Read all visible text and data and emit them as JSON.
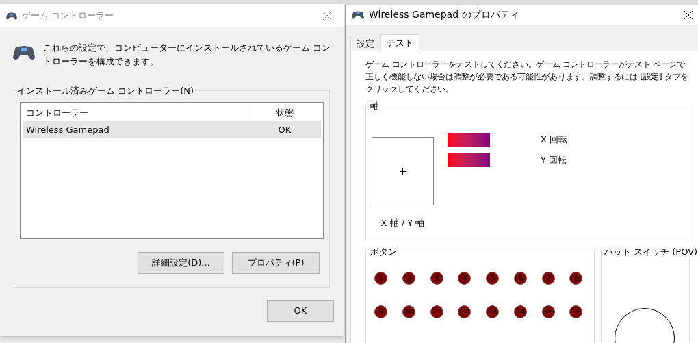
{
  "left_window": {
    "title": "ゲーム コントローラー",
    "description": "これらの設定で、コンピューターにインストールされているゲーム コントローラーを構成できます。",
    "group_label": "インストール済みゲーム コントローラー(N)",
    "columns": [
      "コントローラー",
      "状態"
    ],
    "rows": [
      {
        "name": "Wireless Gamepad",
        "status": "OK",
        "selected": true
      }
    ],
    "buttons": [
      "詳細設定(D)...",
      "プロパティ(P)"
    ],
    "ok_button": "OK"
  },
  "right_window": {
    "title": "Wireless Gamepad のプロパティ",
    "tabs": [
      {
        "label": "設定",
        "selected": false
      },
      {
        "label": "テスト",
        "selected": true
      }
    ],
    "description": "ゲーム コントローラーをテストしてください。ゲーム コントローラーがテスト ページで正しく機能しない場合は調整が必要である可能性があります。調整するには [設定] タブをクリックしてください。",
    "axes": {
      "label": "軸",
      "xy_label": "X 軸 / Y 軸",
      "rotations": [
        {
          "label": "X 回転"
        },
        {
          "label": "Y 回転"
        }
      ]
    },
    "buttons_group": {
      "label": "ボタン",
      "buttons": [
        {
          "label": "1",
          "pressed": false
        },
        {
          "label": "2",
          "pressed": false
        },
        {
          "label": "3",
          "pressed": false
        },
        {
          "label": "4",
          "pressed": false
        },
        {
          "label": "5",
          "pressed": false
        },
        {
          "label": "6",
          "pressed": false
        },
        {
          "label": "7",
          "pressed": false
        },
        {
          "label": "8",
          "pressed": false
        },
        {
          "label": "9",
          "pressed": false
        },
        {
          "label": "10",
          "pressed": false
        },
        {
          "label": "11",
          "pressed": false
        },
        {
          "label": "12",
          "pressed": false
        },
        {
          "label": "13",
          "pressed": false
        },
        {
          "label": "14",
          "pressed": false
        },
        {
          "label": "15",
          "pressed": false
        },
        {
          "label": "16",
          "pressed": false
        }
      ]
    },
    "hat_switch": {
      "label": "ハット スイッチ (POV)"
    }
  }
}
